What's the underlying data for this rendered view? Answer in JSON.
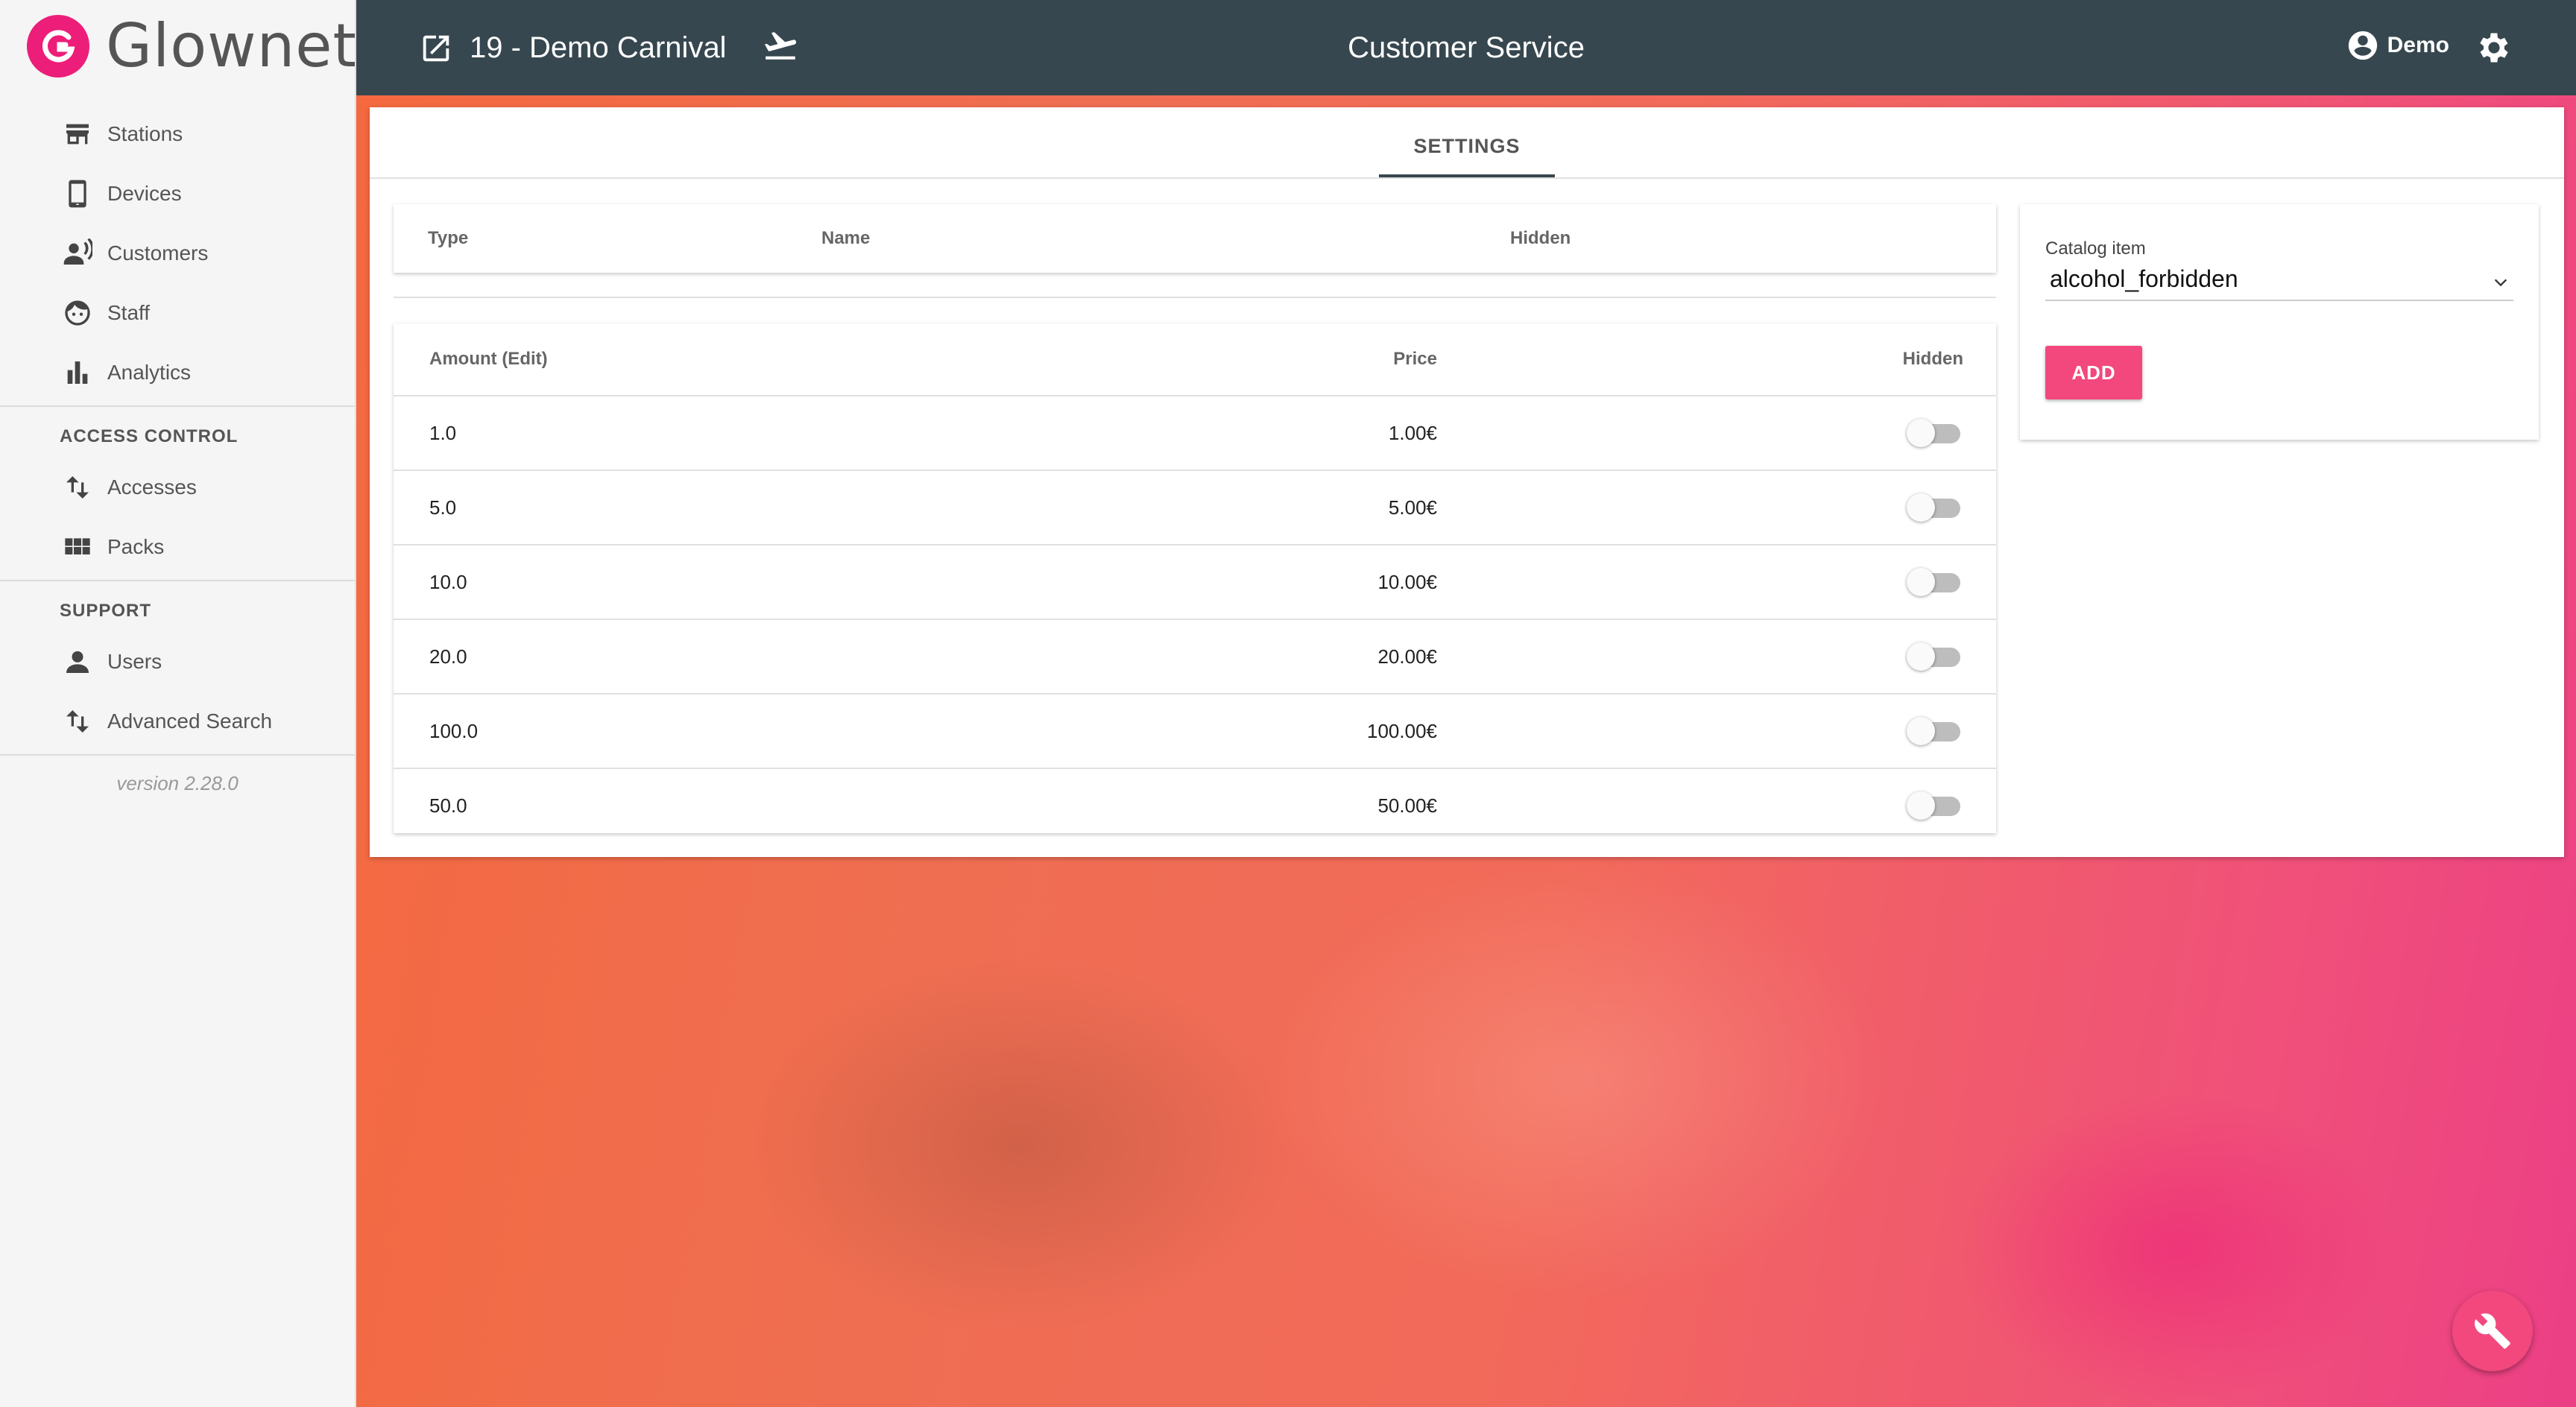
{
  "brand": {
    "name": "Glownet",
    "logo_color": "#ec1e79"
  },
  "sidebar": {
    "items": [
      {
        "label": "Stations",
        "icon": "store-icon"
      },
      {
        "label": "Devices",
        "icon": "phone-icon"
      },
      {
        "label": "Customers",
        "icon": "customers-icon"
      },
      {
        "label": "Staff",
        "icon": "face-icon"
      },
      {
        "label": "Analytics",
        "icon": "bar-chart-icon"
      }
    ],
    "access_control": {
      "title": "ACCESS CONTROL",
      "items": [
        {
          "label": "Accesses",
          "icon": "swap-vertical-icon"
        },
        {
          "label": "Packs",
          "icon": "grid-icon"
        }
      ]
    },
    "support": {
      "title": "SUPPORT",
      "items": [
        {
          "label": "Users",
          "icon": "person-icon"
        },
        {
          "label": "Advanced Search",
          "icon": "swap-vertical-icon"
        }
      ]
    },
    "version": "version 2.28.0"
  },
  "topbar": {
    "event": "19 - Demo Carnival",
    "title": "Customer Service",
    "user": "Demo",
    "bg_color": "#37474f"
  },
  "tabs": [
    {
      "label": "SETTINGS",
      "active": true
    }
  ],
  "catalog_table": {
    "columns": [
      "Type",
      "Name",
      "Hidden"
    ]
  },
  "amounts_table": {
    "columns": [
      "Amount (Edit)",
      "Price",
      "Hidden"
    ],
    "rows": [
      {
        "amount": "1.0",
        "price": "1.00€",
        "hidden": false
      },
      {
        "amount": "5.0",
        "price": "5.00€",
        "hidden": false
      },
      {
        "amount": "10.0",
        "price": "10.00€",
        "hidden": false
      },
      {
        "amount": "20.0",
        "price": "20.00€",
        "hidden": false
      },
      {
        "amount": "100.0",
        "price": "100.00€",
        "hidden": false
      },
      {
        "amount": "50.0",
        "price": "50.00€",
        "hidden": false
      }
    ]
  },
  "catalog_form": {
    "label": "Catalog item",
    "value": "alcohol_forbidden",
    "button": "ADD",
    "accent": "#f2487e"
  },
  "fab": {
    "icon": "wrench-icon"
  }
}
